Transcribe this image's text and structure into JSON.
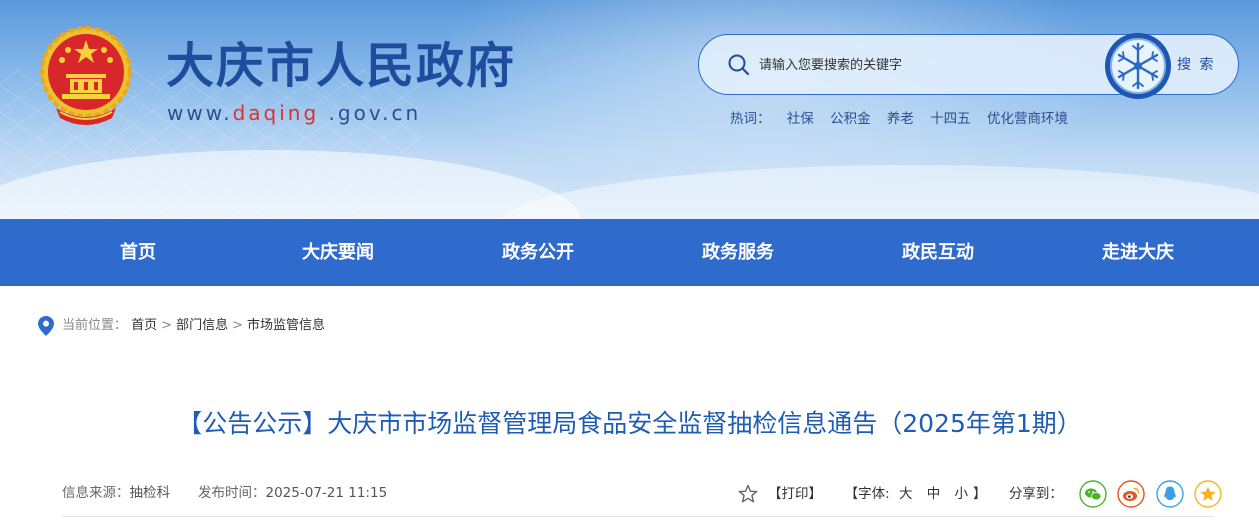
{
  "header": {
    "site_name": "大庆市人民政府",
    "url_prefix": "www.",
    "url_highlight": "daqing",
    "url_suffix": " .gov.cn",
    "search": {
      "placeholder": "请输入您要搜索的关键字",
      "button_label": "搜 索"
    },
    "hot_label": "热词：",
    "hot_words": [
      "社保",
      "公积金",
      "养老",
      "十四五",
      "优化营商环境"
    ]
  },
  "nav": {
    "items": [
      "首页",
      "大庆要闻",
      "政务公开",
      "政务服务",
      "政民互动",
      "走进大庆"
    ]
  },
  "breadcrumb": {
    "prefix": "当前位置：",
    "items": [
      "首页",
      "部门信息",
      "市场监管信息"
    ],
    "separator": ">"
  },
  "article": {
    "title": "【公告公示】大庆市市场监督管理局食品安全监督抽检信息通告（2025年第1期）",
    "source_label": "信息来源：",
    "source": "抽检科",
    "time_label": "发布时间：",
    "time": "2025-07-21 11:15"
  },
  "tools": {
    "print": "【打印】",
    "font_label": "【字体:",
    "font_sizes": [
      "大",
      "中",
      "小"
    ],
    "font_close": "】",
    "share_label": "分享到："
  },
  "colors": {
    "nav_bg": "#2e6bcd",
    "title_blue": "#1f5db5",
    "site_name": "#1f4d9d",
    "url_highlight": "#d9332c"
  },
  "icons": [
    "national-emblem-icon",
    "search-icon",
    "snowflake-badge-icon",
    "location-pin-icon",
    "star-icon",
    "wechat-icon",
    "weibo-icon",
    "qq-icon",
    "qzone-icon"
  ]
}
